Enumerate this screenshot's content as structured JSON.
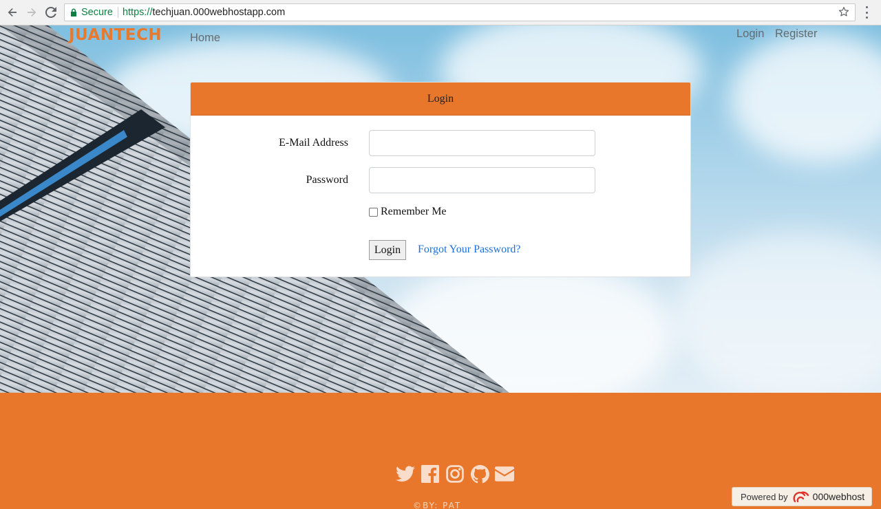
{
  "browser": {
    "secure_label": "Secure",
    "url_scheme": "https://",
    "url_host": "techjuan.000webhostapp.com"
  },
  "header": {
    "brand": "JUANTECH",
    "nav_home": "Home",
    "nav_login": "Login",
    "nav_register": "Register"
  },
  "login_card": {
    "title": "Login",
    "email_label": "E-Mail Address",
    "email_value": "",
    "password_label": "Password",
    "password_value": "",
    "remember_label": "Remember Me",
    "remember_checked": false,
    "submit_label": "Login",
    "forgot_label": "Forgot Your Password?"
  },
  "footer": {
    "social_icons": [
      "twitter-icon",
      "facebook-icon",
      "instagram-icon",
      "github-icon",
      "envelope-icon"
    ],
    "byline": "©BY: PAT"
  },
  "badge": {
    "powered_by": "Powered by",
    "brand_name": "000webhost"
  },
  "colors": {
    "accent_orange": "#e8762b",
    "link_blue": "#1a6fd8",
    "nav_gray": "#636b6f",
    "secure_green": "#0b8043"
  }
}
